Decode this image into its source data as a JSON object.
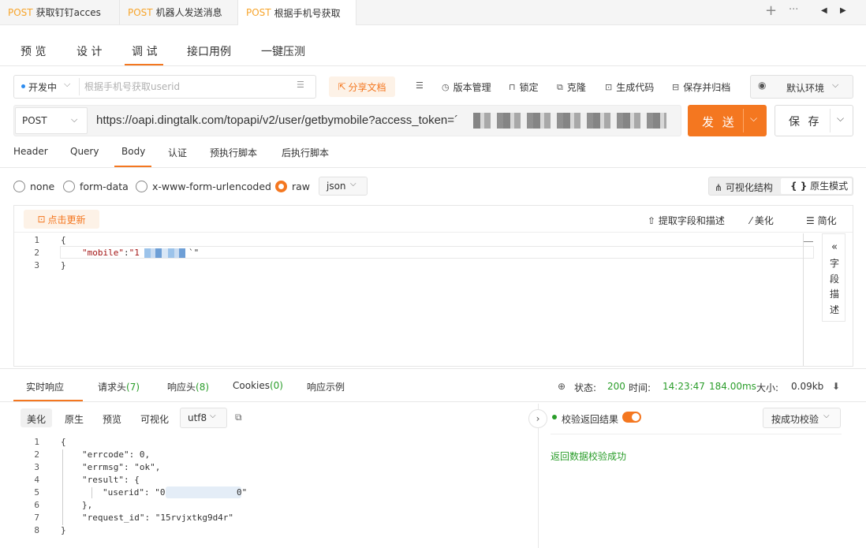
{
  "request_tabs": [
    {
      "method": "POST",
      "name": "获取钉钉acces"
    },
    {
      "method": "POST",
      "name": "机器人发送消息"
    },
    {
      "method": "POST",
      "name": "根据手机号获取"
    }
  ],
  "tabbar_controls": {
    "add": "+",
    "more": "···",
    "prev": "◀",
    "next": "▶"
  },
  "sub_tabs": [
    "预 览",
    "设 计",
    "调 试",
    "接口用例",
    "一键压测"
  ],
  "toolbar": {
    "env": "开发中",
    "desc_placeholder": "根据手机号获取userid",
    "share": "分享文档",
    "version": "版本管理",
    "lock": "锁定",
    "clone": "克隆",
    "gen_code": "生成代码",
    "save_archive": "保存并归档",
    "default_env": "默认环境"
  },
  "request": {
    "method": "POST",
    "url": "https://oapi.dingtalk.com/topapi/v2/user/getbymobile?access_token=´",
    "send": "发 送",
    "save": "保 存"
  },
  "param_tabs": [
    "Header",
    "Query",
    "Body",
    "认证",
    "预执行脚本",
    "后执行脚本"
  ],
  "body_types": [
    "none",
    "form-data",
    "x-www-form-urlencoded",
    "raw"
  ],
  "raw_format": "json",
  "view_modes": {
    "visual": "可视化结构",
    "raw": "原生模式"
  },
  "editor_toolbar": {
    "update": "点击更新",
    "extract": "提取字段和描述",
    "beautify": "美化",
    "simplify": "简化"
  },
  "body_code": {
    "lines": [
      "1",
      "2",
      "3"
    ],
    "l1": "{",
    "l2_key": "\"mobile\"",
    "l2_colon": ":",
    "l2_val_start": "\"1",
    "l2_val_end": "`\"",
    "l3": "}"
  },
  "field_desc": "字段描述",
  "response_tabs": {
    "live": "实时响应",
    "req_headers": "请求头",
    "req_headers_count": "(7)",
    "resp_headers": "响应头",
    "resp_headers_count": "(8)",
    "cookies": "Cookies",
    "cookies_count": "(0)",
    "examples": "响应示例"
  },
  "status": {
    "status_label": "状态:",
    "code": "200",
    "time_label": "时间:",
    "time": "14:23:47",
    "duration": "184.00ms",
    "size_label": "大小:",
    "size": "0.09kb"
  },
  "response_view": [
    "美化",
    "原生",
    "预览",
    "可视化"
  ],
  "encoding": "utf8",
  "response_code": {
    "lines": [
      "1",
      "2",
      "3",
      "4",
      "5",
      "6",
      "7",
      "8"
    ],
    "l1": "{",
    "l2": "\"errcode\": 0,",
    "l3": "\"errmsg\": \"ok\",",
    "l4": "\"result\": {",
    "l5_key": "\"userid\": \"0",
    "l5_end": "0\"",
    "l6": "},",
    "l7": "\"request_id\": \"15rvjxtkg9d4r\"",
    "l8": "}"
  },
  "validation": {
    "label": "校验返回结果",
    "mode": "按成功校验",
    "result": "返回数据校验成功"
  },
  "colors": {
    "accent": "#f47720",
    "success": "#2a9d2a",
    "method": "#f7a42a",
    "env_dot": "#2d8cf0"
  }
}
